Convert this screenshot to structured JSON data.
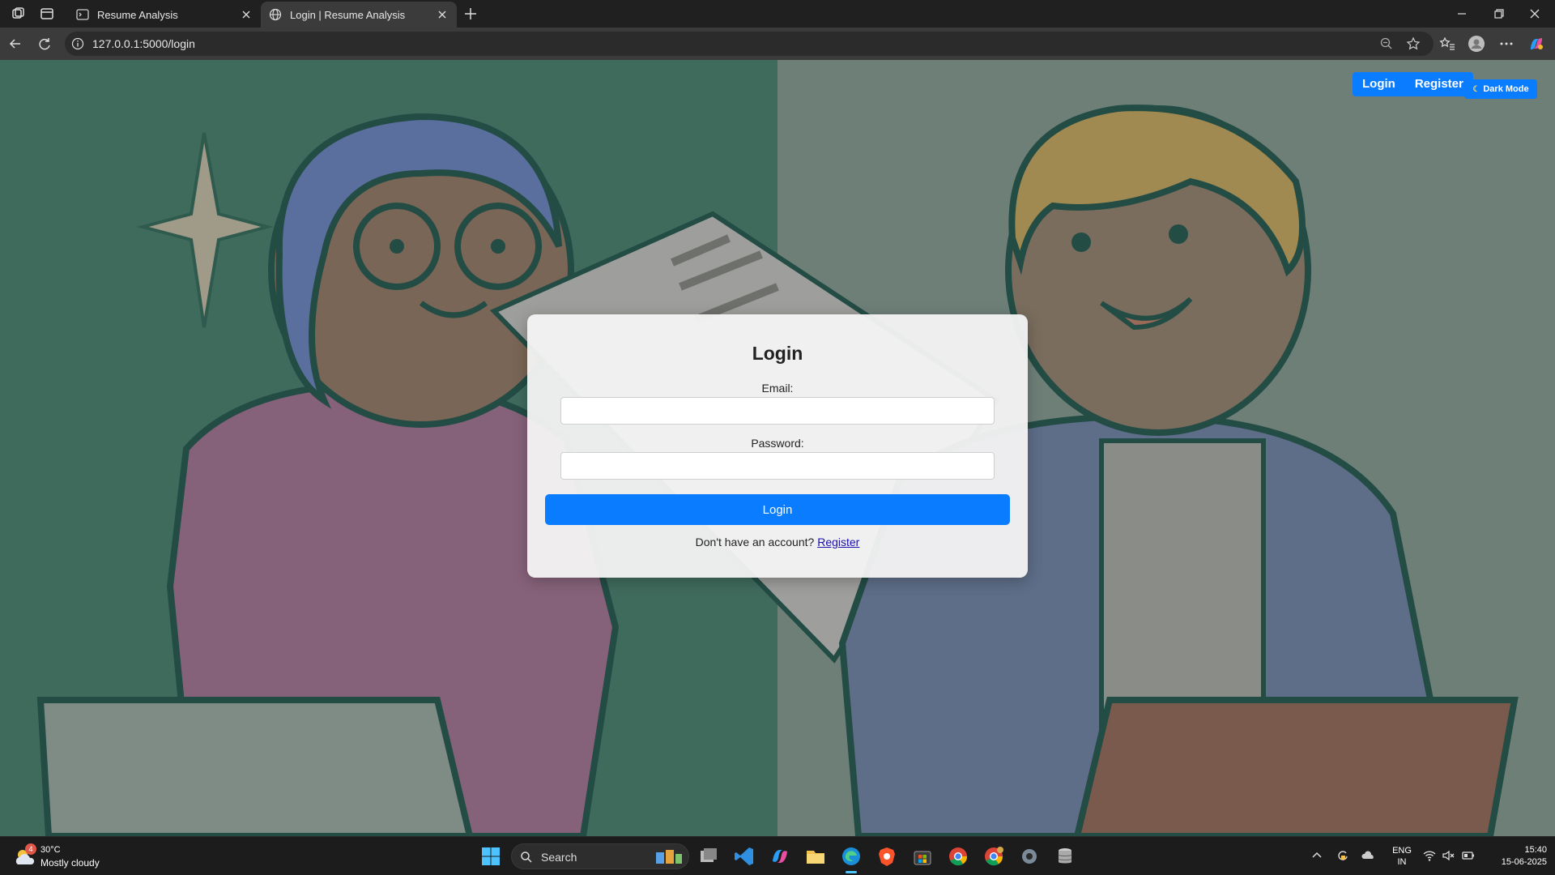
{
  "browser": {
    "tabs": [
      {
        "title": "Resume Analysis"
      },
      {
        "title": "Login | Resume Analysis"
      }
    ],
    "url": "127.0.0.1:5000/login"
  },
  "page": {
    "nav": {
      "login_label": "Login",
      "register_label": "Register",
      "dark_mode_label": "Dark Mode"
    },
    "form": {
      "title": "Login",
      "email_label": "Email:",
      "email_value": "",
      "password_label": "Password:",
      "password_value": "",
      "submit_label": "Login",
      "register_prompt": "Don't have an account?",
      "register_link": "Register"
    }
  },
  "taskbar": {
    "weather": {
      "temperature": "30°C",
      "condition": "Mostly cloudy",
      "badge": "4"
    },
    "search_placeholder": "Search",
    "language": {
      "line1": "ENG",
      "line2": "IN"
    },
    "clock": {
      "time": "15:40",
      "date": "15-06-2025"
    }
  },
  "colors": {
    "accent": "#0a7cff",
    "left_panel": "#3f6b5d",
    "right_panel": "#6e7f78"
  }
}
